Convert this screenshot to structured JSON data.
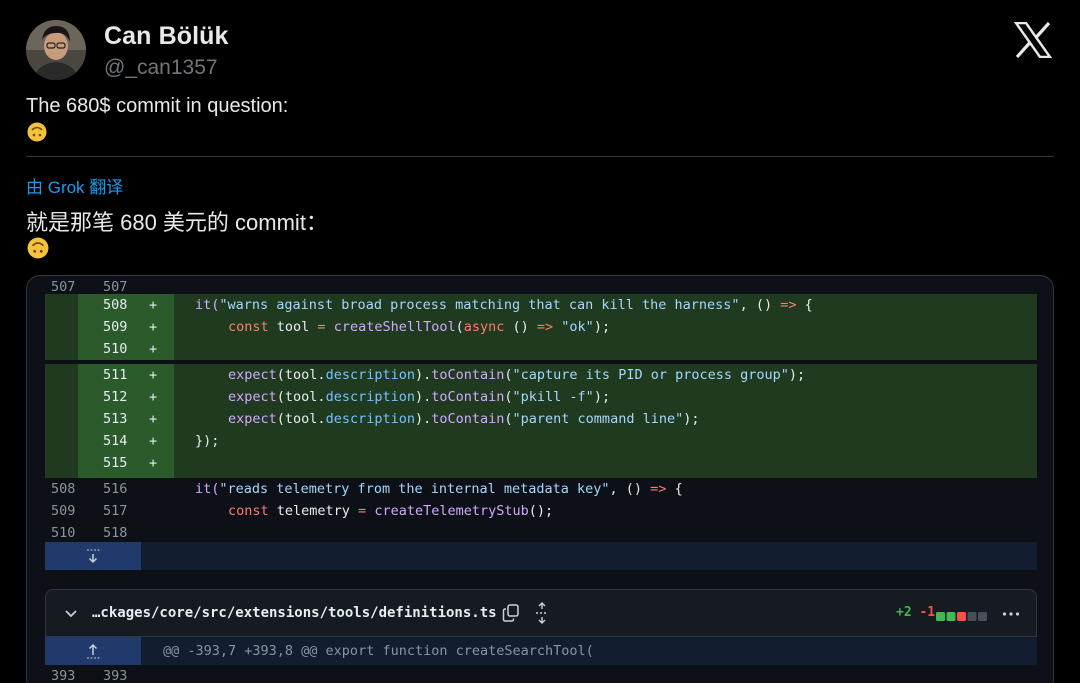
{
  "tweet": {
    "author_name": "Can Bölük",
    "author_handle": "@_can1357",
    "text": "The 680$ commit in question:",
    "translated_by": "由 Grok 翻译",
    "translated_text": "就是那笔 680 美元的 commit：",
    "emoji": "upside-down-face-emoji",
    "brand_icon": "x-logo-icon"
  },
  "colors": {
    "background": "#000000",
    "text": "#e7e9ea",
    "muted": "#71767b",
    "link": "#1d9bf0",
    "added_bg": "#1f3a1f",
    "added_gutter": "#2b5a2b",
    "diff_add": "#3fb950",
    "diff_del": "#f85149"
  },
  "diff": {
    "context_top": {
      "old": "507",
      "new": "507"
    },
    "added_lines": [
      {
        "new": "508",
        "marker": "+"
      },
      {
        "new": "509",
        "marker": "+"
      },
      {
        "new": "510",
        "marker": "+"
      },
      {
        "new": "511",
        "marker": "+"
      },
      {
        "new": "512",
        "marker": "+"
      },
      {
        "new": "513",
        "marker": "+"
      },
      {
        "new": "514",
        "marker": "+"
      },
      {
        "new": "515",
        "marker": "+"
      }
    ],
    "context_bottom": [
      {
        "old": "508",
        "new": "516"
      },
      {
        "old": "509",
        "new": "517"
      },
      {
        "old": "510",
        "new": "518"
      }
    ],
    "code": {
      "l508": {
        "a": "it(",
        "b": "\"warns against broad process matching that can kill the harness\"",
        "c": ", () ",
        "d": "=>",
        "e": " {"
      },
      "l509": {
        "a": "const",
        "b": " tool ",
        "c": "=",
        "d": " createShellTool",
        "e": "(",
        "f": "async",
        "g": " () ",
        "h": "=>",
        "i": " \"ok\"",
        "j": ");"
      },
      "l511": {
        "a": "expect",
        "b": "(tool.",
        "c": "description",
        "d": ").",
        "e": "toContain",
        "f": "(",
        "g": "\"capture its PID or process group\"",
        "h": ");"
      },
      "l512": {
        "a": "expect",
        "b": "(tool.",
        "c": "description",
        "d": ").",
        "e": "toContain",
        "f": "(",
        "g": "\"pkill -f\"",
        "h": ");"
      },
      "l513": {
        "a": "expect",
        "b": "(tool.",
        "c": "description",
        "d": ").",
        "e": "toContain",
        "f": "(",
        "g": "\"parent command line\"",
        "h": ");"
      },
      "l514": {
        "a": "});"
      },
      "l516": {
        "a": "it(",
        "b": "\"reads telemetry from the internal metadata key\"",
        "c": ", () ",
        "d": "=>",
        "e": " {"
      },
      "l517": {
        "a": "const",
        "b": " telemetry ",
        "c": "=",
        "d": " createTelemetryStub",
        "e": "();"
      }
    },
    "expand_icon": "expand-down-icon"
  },
  "file": {
    "path": "…ckages/core/src/extensions/tools/definitions.ts",
    "additions": "+2",
    "deletions": "-1",
    "hunk": "@@ -393,7 +393,8 @@ export function createSearchTool(",
    "first_line_old": "393",
    "first_line_new": "393"
  }
}
